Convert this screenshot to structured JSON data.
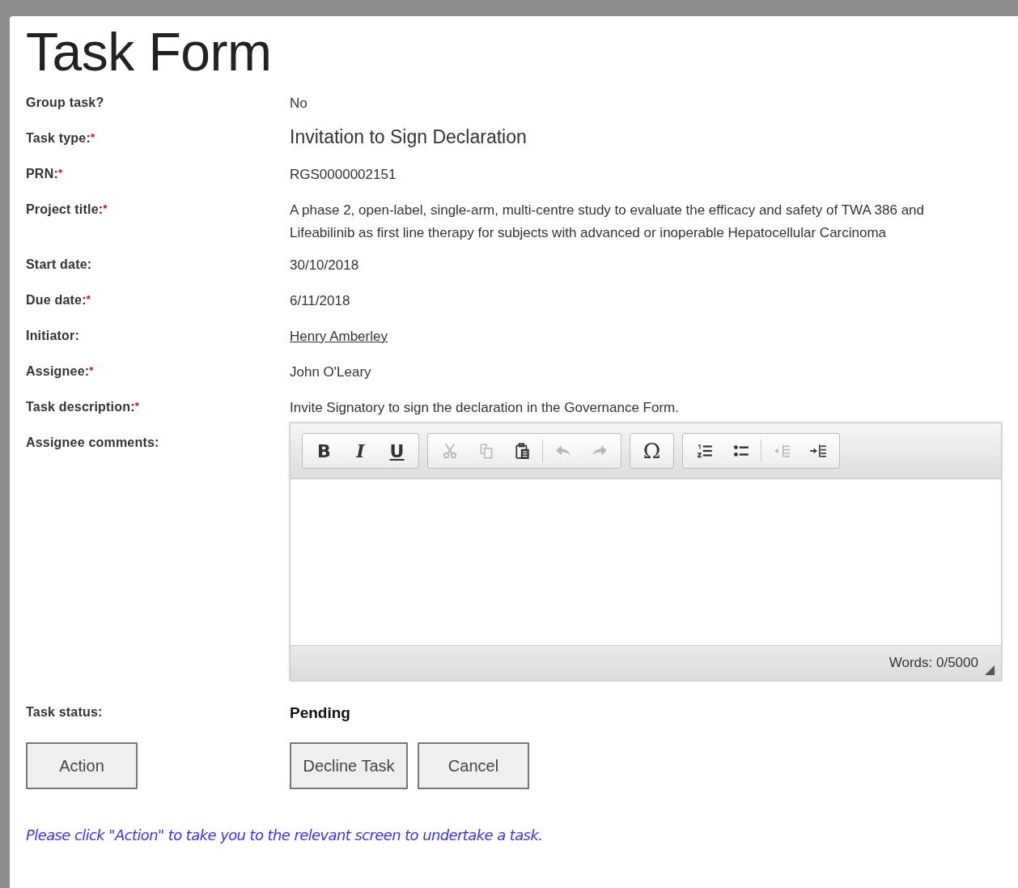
{
  "title": "Task Form",
  "required_marker": "*",
  "fields": [
    {
      "label": "Group task?",
      "required": false,
      "kind": "text",
      "value": "No"
    },
    {
      "label": "Task type:",
      "required": true,
      "kind": "large",
      "value": "Invitation to Sign Declaration"
    },
    {
      "label": "PRN:",
      "required": true,
      "kind": "text",
      "value": "RGS0000002151"
    },
    {
      "label": "Project title:",
      "required": true,
      "kind": "text",
      "value": "A phase 2, open-label, single-arm, multi-centre study to evaluate the efficacy and safety of TWA 386 and Lifeabilinib as first line therapy for subjects with advanced or inoperable Hepatocellular Carcinoma"
    },
    {
      "label": "Start date:",
      "required": false,
      "kind": "text",
      "value": "30/10/2018"
    },
    {
      "label": "Due date:",
      "required": true,
      "kind": "text",
      "value": "6/11/2018"
    },
    {
      "label": "Initiator:",
      "required": false,
      "kind": "link",
      "value": "Henry Amberley"
    },
    {
      "label": "Assignee:",
      "required": true,
      "kind": "text",
      "value": "John O'Leary"
    },
    {
      "label": "Task description:",
      "required": true,
      "kind": "text",
      "value": "Invite Signatory to sign the declaration in the Governance Form."
    }
  ],
  "comments": {
    "label": "Assignee comments:",
    "toolbar": [
      [
        {
          "kind": "bold",
          "text": "B",
          "disabled": false
        },
        {
          "kind": "italic",
          "text": "I",
          "disabled": false
        },
        {
          "kind": "underline",
          "text": "U",
          "disabled": false
        }
      ],
      [
        {
          "kind": "cut",
          "disabled": true
        },
        {
          "kind": "copy",
          "disabled": true
        },
        {
          "kind": "paste",
          "disabled": false
        },
        {
          "kind": "separator"
        },
        {
          "kind": "undo",
          "disabled": true
        },
        {
          "kind": "redo",
          "disabled": true
        }
      ],
      [
        {
          "kind": "symbol",
          "text": "Ω",
          "disabled": false
        }
      ],
      [
        {
          "kind": "numbered-list",
          "disabled": false
        },
        {
          "kind": "bullet-list",
          "disabled": false
        },
        {
          "kind": "separator"
        },
        {
          "kind": "outdent",
          "disabled": true
        },
        {
          "kind": "indent",
          "disabled": false
        }
      ]
    ],
    "word_count": "Words: 0/5000"
  },
  "status": {
    "label": "Task status:",
    "value": "Pending"
  },
  "left_buttons": [
    "Action"
  ],
  "right_buttons": [
    "Decline Task",
    "Cancel"
  ],
  "note": "Please click \"Action\" to take you to the relevant screen to undertake a task."
}
